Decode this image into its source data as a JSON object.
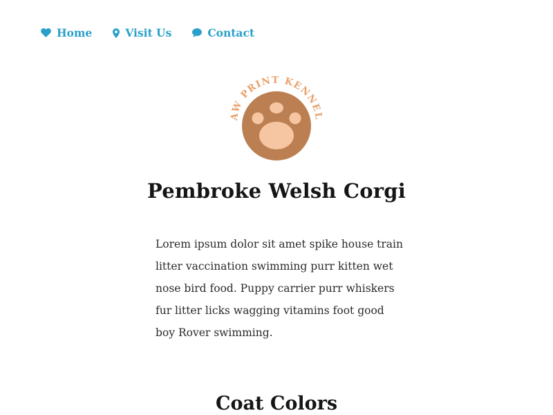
{
  "nav": {
    "items": [
      {
        "label": "Home",
        "icon": "heart-icon"
      },
      {
        "label": "Visit Us",
        "icon": "map-pin-icon"
      },
      {
        "label": "Contact",
        "icon": "chat-bubble-icon"
      }
    ]
  },
  "logo": {
    "text": "PAW PRINT KENNELS"
  },
  "page": {
    "title": "Pembroke Welsh Corgi",
    "description": "Lorem ipsum dolor sit amet spike house train litter vaccination swimming purr kitten wet nose bird food. Puppy carrier purr whiskers fur litter licks wagging vitamins foot good boy Rover swimming.",
    "section_title": "Coat Colors"
  },
  "colors": {
    "accent": "#2aa0c8",
    "logo_brown": "#bb7f52",
    "logo_pad": "#f5c6a1",
    "logo_text": "#e8a06a"
  }
}
